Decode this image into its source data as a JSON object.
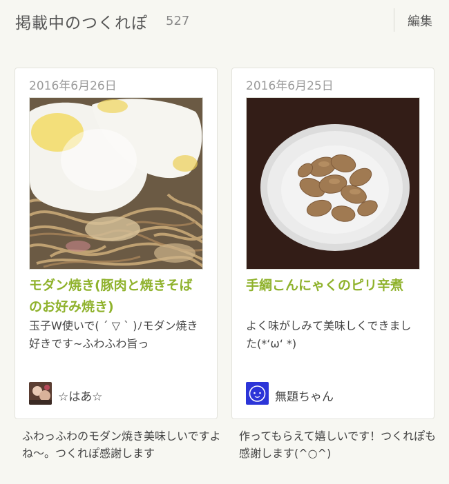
{
  "header": {
    "title": "掲載中のつくれぽ",
    "count": "527",
    "edit_label": "編集"
  },
  "cards": [
    {
      "date": "2016年6月26日",
      "title": "モダン焼き(豚肉と焼きそばのお好み焼き)",
      "comment": "玉子W使いで( ´ ▽ ` )ﾉモダン焼き好きです~ふわふわ旨っ",
      "author": "☆はあ☆",
      "reply": "ふわっふわのモダン焼き美味しいですよね〜。つくれぽ感謝します"
    },
    {
      "date": "2016年6月25日",
      "title": "手綱こんにゃくのピリ辛煮",
      "comment": "よく味がしみて美味しくできました(*‘ω‘ *)",
      "author": "無題ちゃん",
      "reply": "作ってもらえて嬉しいです！つくれぽも感謝します(^○^)"
    }
  ],
  "colors": {
    "background": "#f7f7f2",
    "accent_green": "#8fb22c",
    "date_gray": "#9a9a9a"
  }
}
